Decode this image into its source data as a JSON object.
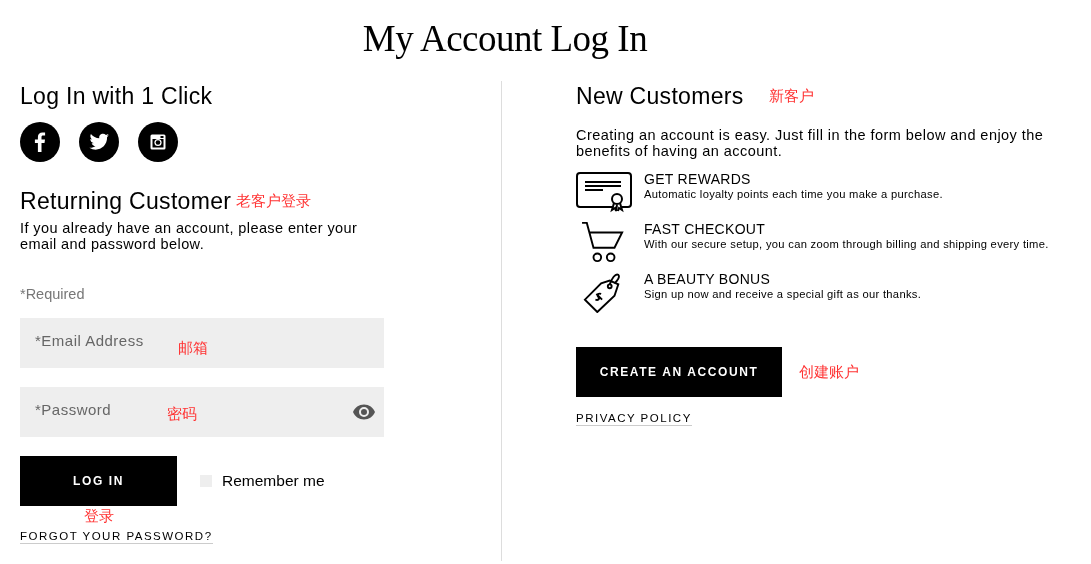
{
  "title": "My Account Log In",
  "quick_login": {
    "heading": "Log In with 1 Click"
  },
  "returning": {
    "heading": "Returning Customer",
    "note": "老客户登录",
    "text": "If you already have an account, please enter your email and password below.",
    "required": "*Required",
    "email": {
      "placeholder": "*Email Address",
      "note": "邮箱"
    },
    "password": {
      "placeholder": "*Password",
      "note": "密码"
    },
    "login_button": "LOG IN",
    "login_note": "登录",
    "remember": {
      "label": "Remember me",
      "checked": false
    },
    "forgot_link": "FORGOT YOUR PASSWORD?"
  },
  "new_customers": {
    "heading": "New Customers",
    "note": "新客户",
    "text": "Creating an account is easy. Just fill in the form below and enjoy the benefits of having an account.",
    "benefits": [
      {
        "kind": "rewards",
        "title": "GET REWARDS",
        "text": "Automatic loyalty points each time you make a purchase."
      },
      {
        "kind": "checkout",
        "title": "FAST CHECKOUT",
        "text": "With our secure setup, you can zoom through billing and shipping every time."
      },
      {
        "kind": "bonus",
        "title": "A BEAUTY BONUS",
        "text": "Sign up now and receive a special gift as our thanks."
      }
    ],
    "create_button": "CREATE AN ACCOUNT",
    "create_note": "创建账户",
    "privacy_link": "PRIVACY POLICY"
  }
}
